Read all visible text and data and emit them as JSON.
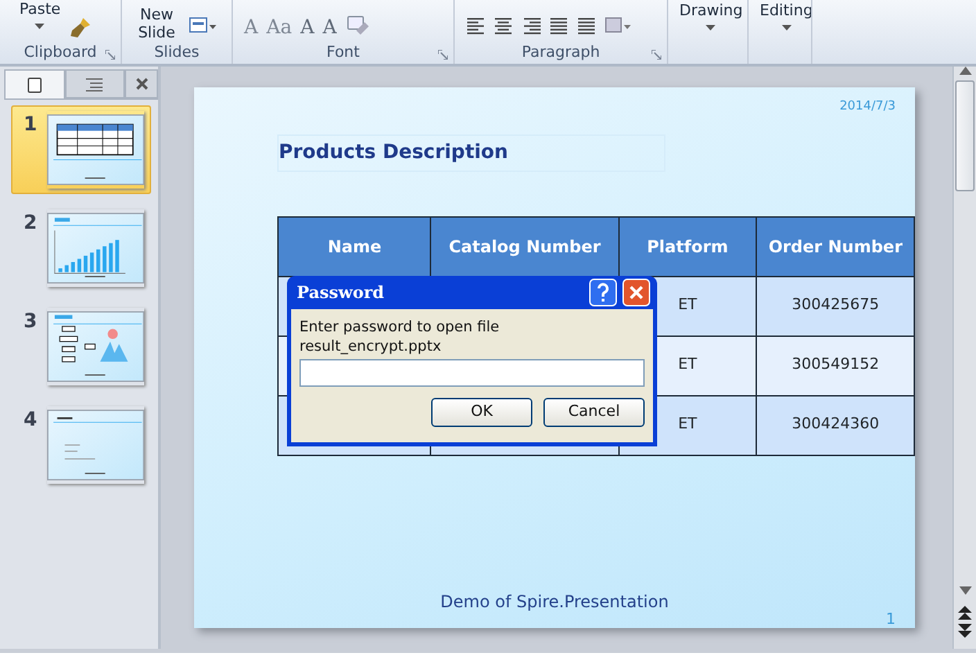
{
  "ribbon": {
    "groups": [
      {
        "label": "Clipboard",
        "launcher": true,
        "kind": "clipboard"
      },
      {
        "label": "Slides",
        "launcher": false,
        "kind": "slides"
      },
      {
        "label": "Font",
        "launcher": true,
        "kind": "font"
      },
      {
        "label": "Paragraph",
        "launcher": true,
        "kind": "paragraph"
      },
      {
        "button_label": "Drawing",
        "launcher": false,
        "kind": "drawing"
      },
      {
        "button_label": "Editing",
        "launcher": false,
        "kind": "editing"
      }
    ],
    "paste_label": "Paste",
    "new_slide_label": "New Slide",
    "font_buttons": [
      "A",
      "Aa",
      "A",
      "A"
    ]
  },
  "slides_pane": {
    "slides": [
      {
        "number": "1",
        "selected": true,
        "kind": "table"
      },
      {
        "number": "2",
        "selected": false,
        "kind": "chart"
      },
      {
        "number": "3",
        "selected": false,
        "kind": "diagram"
      },
      {
        "number": "4",
        "selected": false,
        "kind": "text"
      }
    ]
  },
  "slide": {
    "date": "2014/7/3",
    "title": "Products Description",
    "table": {
      "columns": [
        "Name",
        "Catalog Number",
        "Platform",
        "Order Number"
      ],
      "rows": [
        {
          "platform": "ET",
          "order_number": "300425675"
        },
        {
          "platform": "ET",
          "order_number": "300549152"
        },
        {
          "platform": "ET",
          "order_number": "300424360"
        }
      ]
    },
    "footer": "Demo of Spire.Presentation",
    "page_number": "1"
  },
  "dialog": {
    "title": "Password",
    "message": "Enter password to open file",
    "file_name": "result_encrypt.pptx",
    "buttons": [
      "OK",
      "Cancel"
    ]
  }
}
